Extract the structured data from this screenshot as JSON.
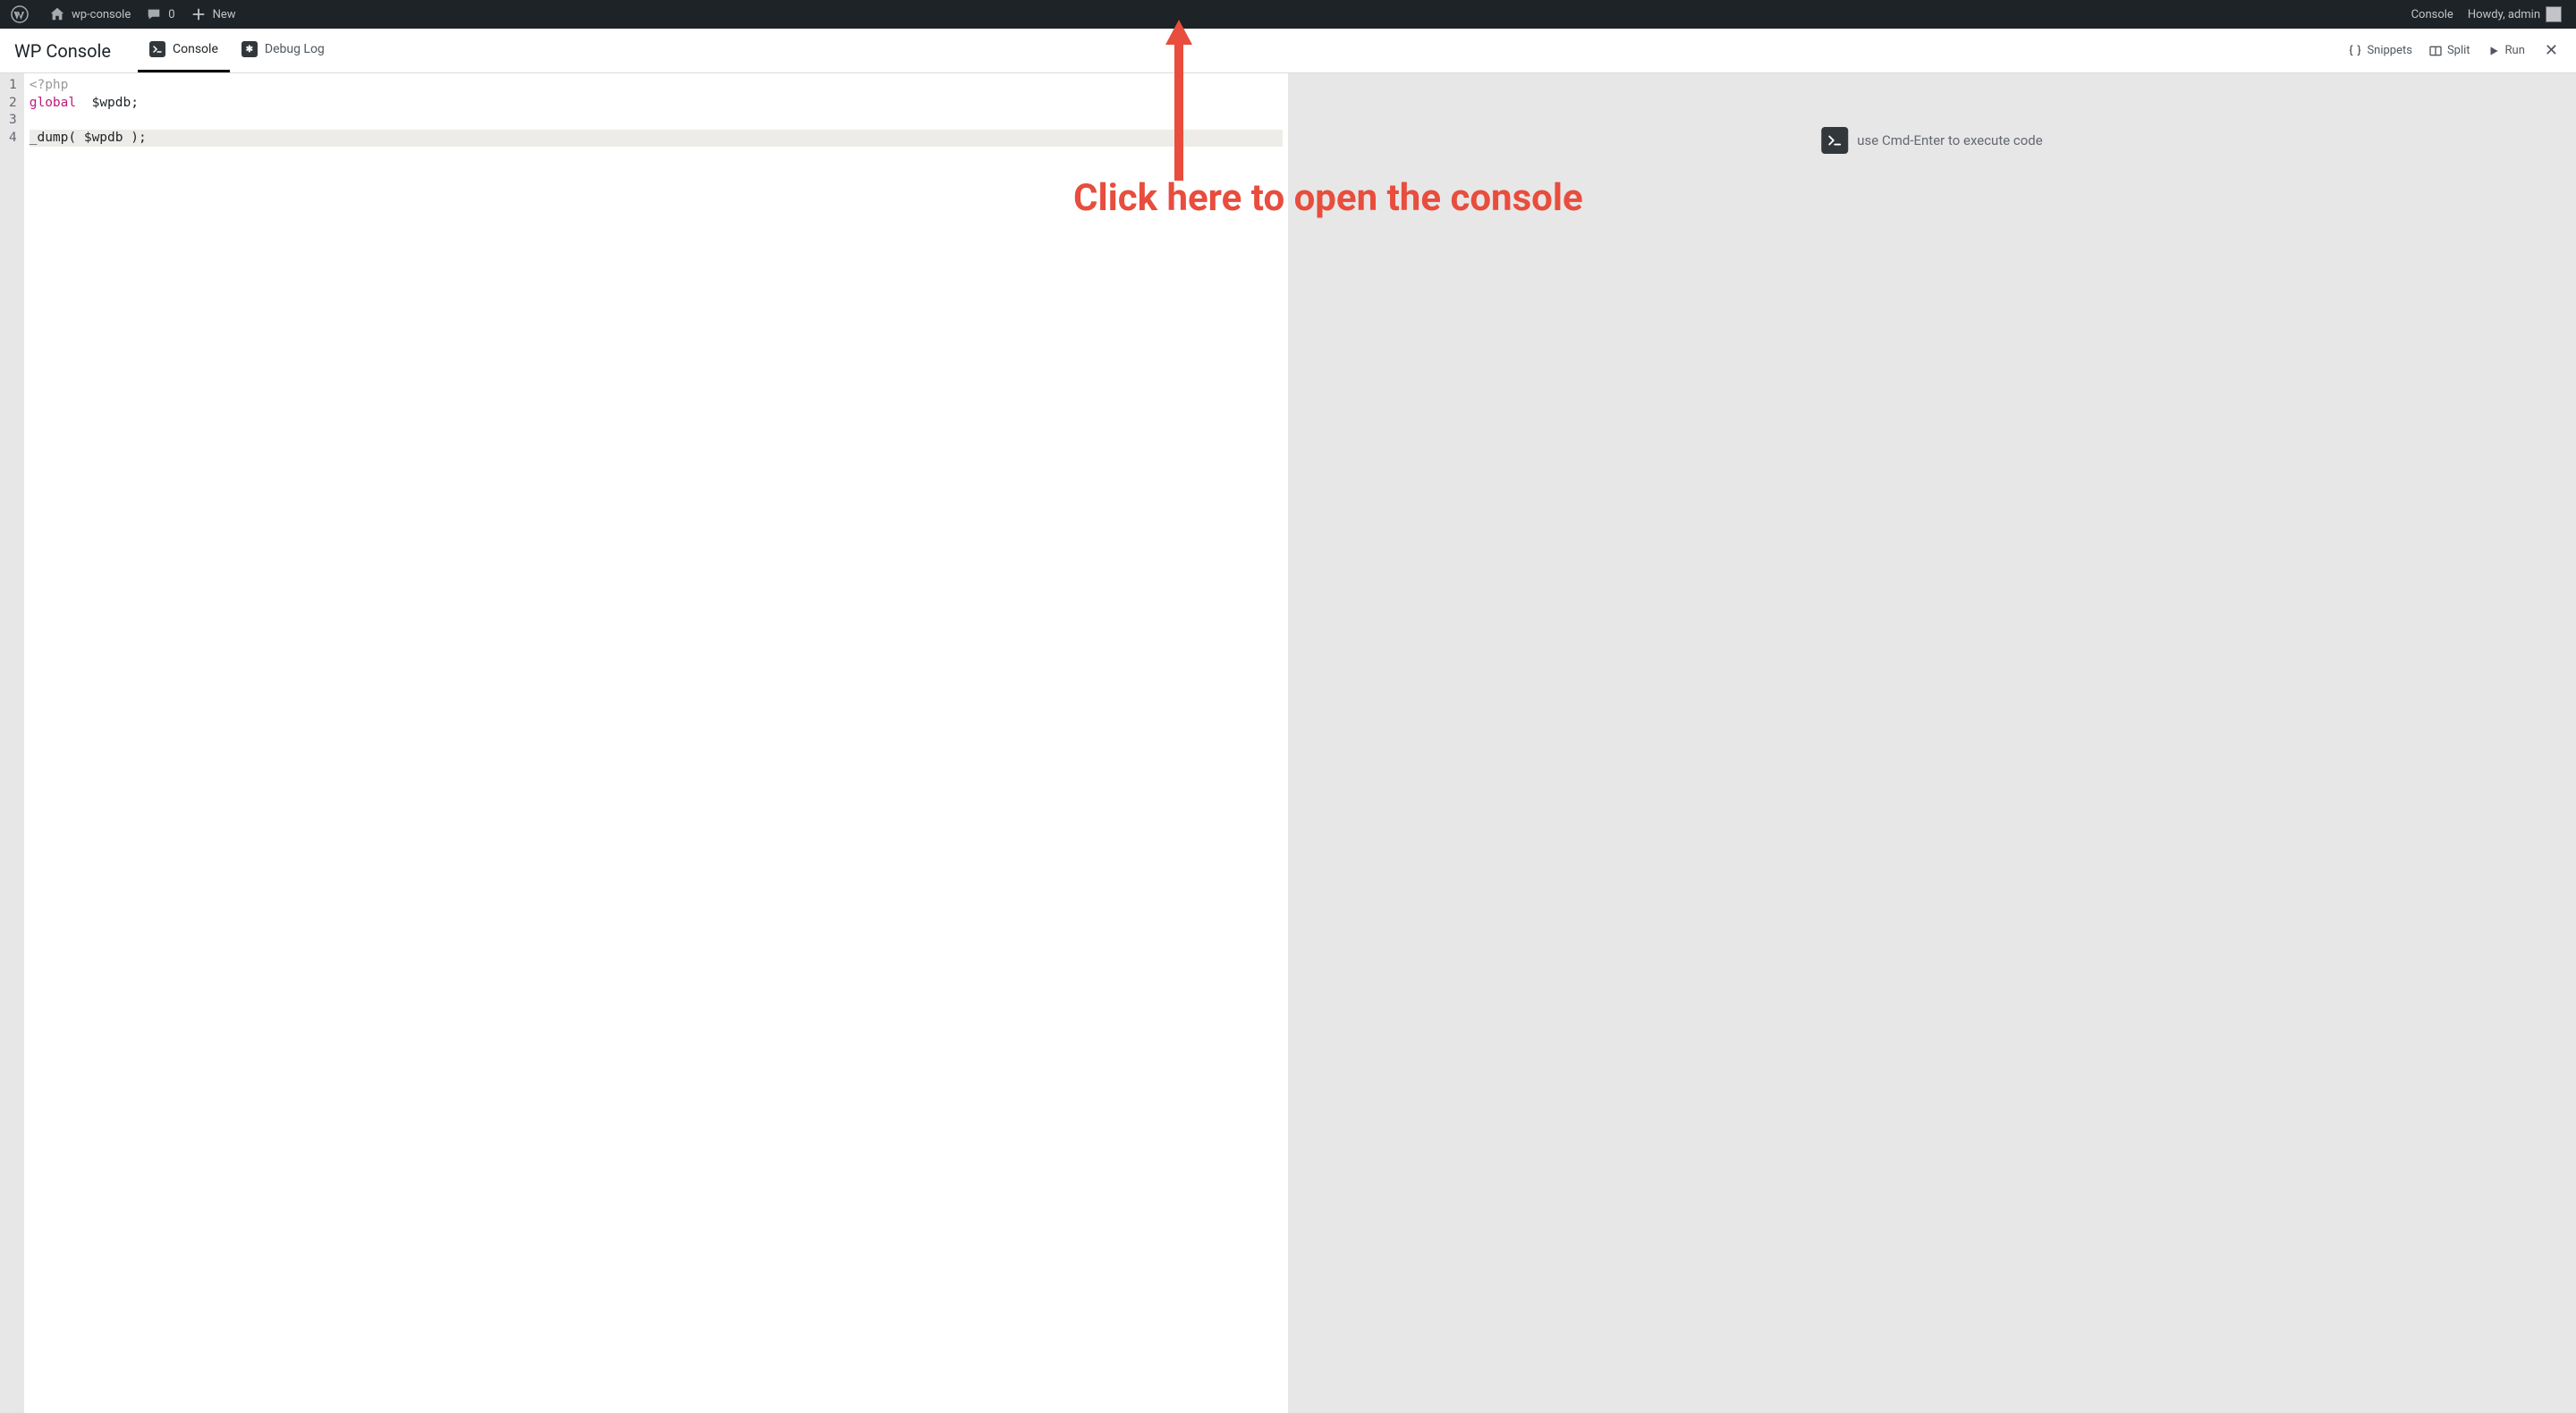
{
  "adminbar": {
    "site_name": "wp-console",
    "comments_count": "0",
    "new_label": "New",
    "console_label": "Console",
    "howdy_text": "Howdy, admin"
  },
  "panel": {
    "title": "WP Console",
    "tabs": {
      "console": "Console",
      "debug_log": "Debug Log"
    },
    "actions": {
      "snippets": "Snippets",
      "split": "Split",
      "run": "Run"
    }
  },
  "editor": {
    "gutter": [
      "1",
      "2",
      "3",
      "4"
    ],
    "line1_tag": "<?php",
    "line2_kw": "global",
    "line2_rest": "  $wpdb;",
    "line3": "",
    "line4": "_dump( $wpdb );"
  },
  "output": {
    "hint": "use Cmd-Enter to execute code"
  },
  "annotation": {
    "text": "Click here to\nopen the\nconsole"
  }
}
